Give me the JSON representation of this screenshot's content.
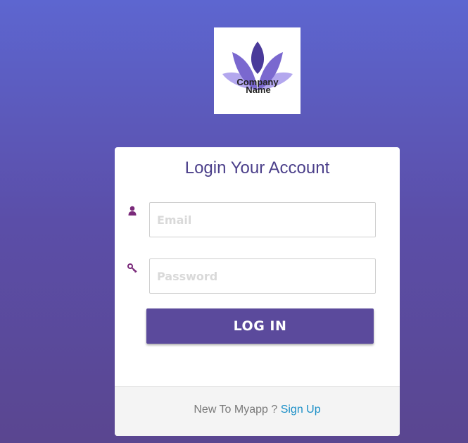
{
  "logo": {
    "line1": "Company",
    "line2": "Name",
    "colors": {
      "light_petal": "#b3a7ee",
      "mid_petal": "#7a68cf",
      "dark_petal": "#4a3a9a",
      "text": "#222222"
    }
  },
  "login": {
    "title": "Login Your Account",
    "email": {
      "icon": "user-icon",
      "placeholder": "Email",
      "value": ""
    },
    "password": {
      "icon": "key-icon",
      "placeholder": "Password",
      "value": ""
    },
    "submit_label": "LOG IN"
  },
  "footer": {
    "prompt": "New To Myapp ?",
    "signup_label": "Sign Up"
  },
  "colors": {
    "accent": "#5b4a9c",
    "icon": "#7a2a7a",
    "link": "#1b8fc7",
    "title": "#4b3f8a"
  }
}
